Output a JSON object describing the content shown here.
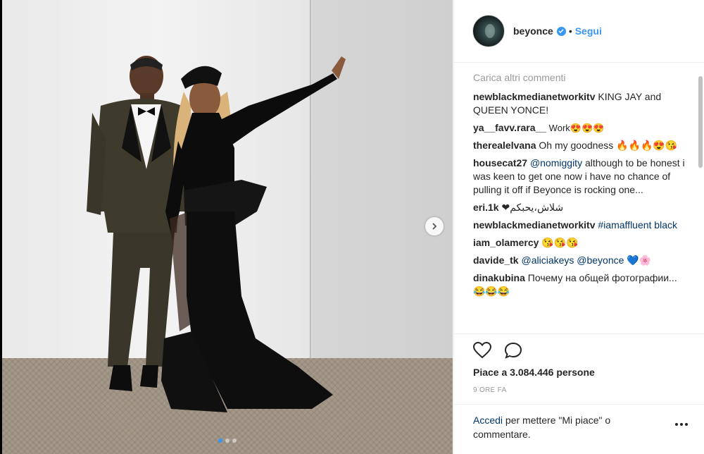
{
  "post": {
    "image_alt": "",
    "carousel_total": 3,
    "carousel_index": 1
  },
  "header": {
    "username": "beyonce",
    "separator": "•",
    "follow_label": "Segui",
    "avatar_icon": "avatar-image",
    "verified_icon": "verified-badge-icon"
  },
  "comments": {
    "load_more": "Carica altri commenti",
    "items": [
      {
        "user": "newblackmedianetworkitv",
        "text": " KING JAY and QUEEN YONCE!"
      },
      {
        "user": "ya__favv.rara__",
        "text": " Work😍😍😍"
      },
      {
        "user": "therealelvana",
        "text": " Oh my goodness 🔥🔥🔥😍😘"
      },
      {
        "user": "housecat27",
        "mention": "@nomiggity",
        "text": " although to be honest i was keen to get one now i have no chance of pulling it off if Beyonce is rocking one..."
      },
      {
        "user": "eri.1k",
        "text": " ❤شلاش،یحبکم"
      },
      {
        "user": "newblackmedianetworkitv",
        "hashtag": "#iamaffluent black"
      },
      {
        "user": "iam_olamercy",
        "text": " 😘😘😘"
      },
      {
        "user": "davide_tk",
        "mention": "@aliciakeys @beyonce",
        "text": " 💙🌸"
      },
      {
        "user": "dinakubina",
        "text": " Почему на общей фотографии...😂😂😂"
      }
    ]
  },
  "actions": {
    "like_icon": "heart-icon",
    "comment_icon": "comment-bubble-icon",
    "likes_text": "Piace a 3.084.446 persone",
    "timestamp": "9 ORE FA"
  },
  "login": {
    "link": "Accedi",
    "text": " per mettere \"Mi piace\" o commentare.",
    "more_icon": "more-options-icon"
  },
  "colors": {
    "accent": "#3897f0",
    "link": "#003569",
    "text": "#262626",
    "muted": "#999999"
  }
}
